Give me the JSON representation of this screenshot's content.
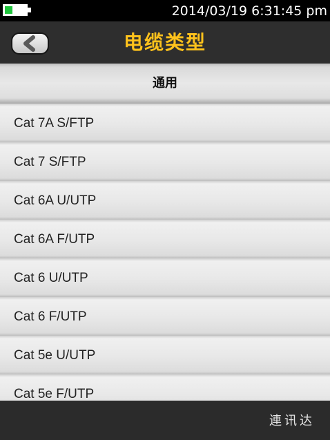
{
  "status_bar": {
    "datetime": "2014/03/19 6:31:45 pm",
    "battery_level": 0.35,
    "battery_color": "#1fc43c"
  },
  "header": {
    "title": "电缆类型",
    "title_color": "#ffc21c",
    "back_icon": "chevron-left-icon"
  },
  "section": {
    "label": "通用"
  },
  "list": {
    "items": [
      {
        "label": "Cat 7A S/FTP"
      },
      {
        "label": "Cat 7 S/FTP"
      },
      {
        "label": "Cat 6A U/UTP"
      },
      {
        "label": "Cat 6A F/UTP"
      },
      {
        "label": "Cat 6 U/UTP"
      },
      {
        "label": "Cat 6 F/UTP"
      },
      {
        "label": "Cat 5e U/UTP"
      },
      {
        "label": "Cat 5e F/UTP"
      }
    ]
  },
  "footer": {
    "brand": "連讯达"
  }
}
